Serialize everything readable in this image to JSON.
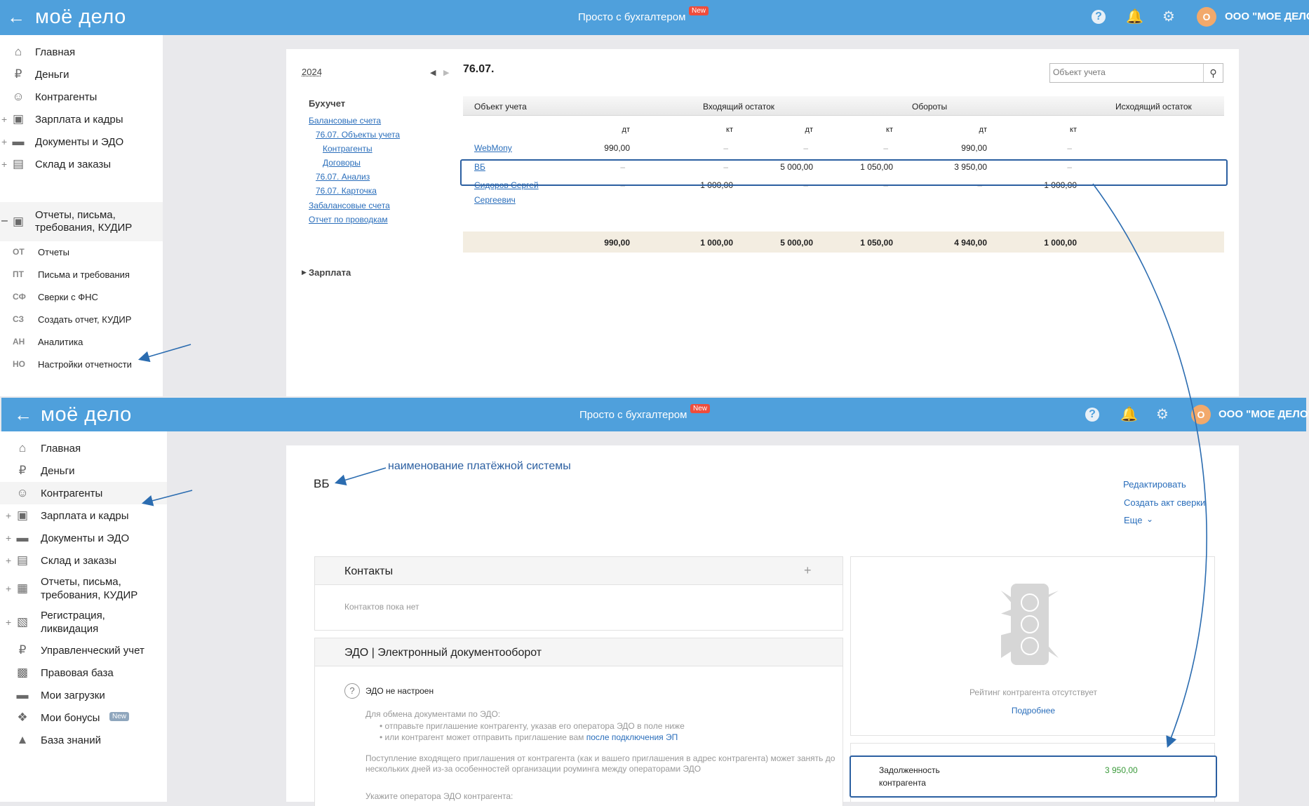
{
  "header": {
    "back_icon": "arrow-left-icon",
    "logo": "моё дело",
    "promo": "Просто с бухгалтером",
    "new_badge": "New",
    "avatar_letter": "О",
    "org_name": "ООО \"МОЕ ДЕЛО\"",
    "icons": [
      "help-icon",
      "bell-icon",
      "gear-icon"
    ]
  },
  "sidebar_top": {
    "items": [
      {
        "label": "Главная",
        "icon": "home-icon",
        "plus": ""
      },
      {
        "label": "Деньги",
        "icon": "money-icon",
        "plus": ""
      },
      {
        "label": "Контрагенты",
        "icon": "person-icon",
        "plus": ""
      },
      {
        "label": "Зарплата и кадры",
        "icon": "wallet-icon",
        "plus": "+"
      },
      {
        "label": "Документы и ЭДО",
        "icon": "folder-icon",
        "plus": "+"
      },
      {
        "label": "Склад и заказы",
        "icon": "cart-icon",
        "plus": "+"
      }
    ],
    "reports": {
      "minus": "–",
      "line1": "Отчеты, письма,",
      "line2": "требования, КУДИР"
    },
    "subitems": [
      {
        "abbr": "ОТ",
        "label": "Отчеты"
      },
      {
        "abbr": "ПТ",
        "label": "Письма и требования"
      },
      {
        "abbr": "СФ",
        "label": "Сверки с ФНС"
      },
      {
        "abbr": "СЗ",
        "label": "Создать отчет, КУДИР"
      },
      {
        "abbr": "АН",
        "label": "Аналитика"
      },
      {
        "abbr": "НО",
        "label": "Настройки отчетности"
      }
    ]
  },
  "report": {
    "year": "2024",
    "title": "76.07.",
    "search_placeholder": "Объект учета",
    "nav": {
      "section": "Бухучет",
      "links": [
        "Балансовые счета",
        "76.07. Объекты учета",
        "Контрагенты",
        "Договоры",
        "76.07. Анализ",
        "76.07. Карточка",
        "Забалансовые счета",
        "Отчет по проводкам"
      ],
      "salary": "Зарплата"
    },
    "table": {
      "headers": [
        "Объект учета",
        "Входящий остаток",
        "Обороты",
        "Исходящий остаток"
      ],
      "sub": [
        "дт",
        "кт",
        "дт",
        "кт",
        "дт",
        "кт"
      ],
      "rows": [
        {
          "name": "WebMony",
          "name2": "",
          "v": [
            "990,00",
            "–",
            "–",
            "–",
            "990,00",
            "–"
          ]
        },
        {
          "name": "ВБ",
          "name2": "",
          "v": [
            "–",
            "–",
            "5 000,00",
            "1 050,00",
            "3 950,00",
            "–"
          ]
        },
        {
          "name": "Сидоров Сергей",
          "name2": "Сергеевич",
          "v": [
            "–",
            "1 000,00",
            "–",
            "–",
            "–",
            "1 000,00"
          ]
        }
      ],
      "totals": [
        "990,00",
        "1 000,00",
        "5 000,00",
        "1 050,00",
        "4 940,00",
        "1 000,00"
      ]
    }
  },
  "sidebar_bottom": {
    "items": [
      {
        "label": "Главная",
        "label2": "",
        "icon": "home-icon",
        "plus": ""
      },
      {
        "label": "Деньги",
        "label2": "",
        "icon": "money-icon",
        "plus": ""
      },
      {
        "label": "Контрагенты",
        "label2": "",
        "icon": "person-icon",
        "plus": ""
      },
      {
        "label": "Зарплата и кадры",
        "label2": "",
        "icon": "wallet-icon",
        "plus": "+"
      },
      {
        "label": "Документы и ЭДО",
        "label2": "",
        "icon": "folder-icon",
        "plus": "+"
      },
      {
        "label": "Склад и заказы",
        "label2": "",
        "icon": "cart-icon",
        "plus": "+"
      },
      {
        "label": "Отчеты, письма,",
        "label2": "требования, КУДИР",
        "icon": "report-icon",
        "plus": "+"
      },
      {
        "label": "Регистрация,",
        "label2": "ликвидация",
        "icon": "registration-icon",
        "plus": "+"
      },
      {
        "label": "Управленческий учет",
        "label2": "",
        "icon": "ruble-icon",
        "plus": ""
      },
      {
        "label": "Правовая база",
        "label2": "",
        "icon": "briefcase-icon",
        "plus": ""
      },
      {
        "label": "Мои загрузки",
        "label2": "",
        "icon": "folder-icon",
        "plus": ""
      },
      {
        "label": "Мои бонусы",
        "label2": "",
        "icon": "gift-icon",
        "plus": "",
        "badge": "New"
      },
      {
        "label": "База знаний",
        "label2": "",
        "icon": "graduation-icon",
        "plus": ""
      }
    ]
  },
  "card": {
    "name": "ВБ",
    "annotation": "наименование платёжной системы",
    "actions": [
      "Редактировать",
      "Создать акт сверки",
      "Еще"
    ],
    "contacts": {
      "title": "Контакты",
      "add": "+",
      "empty": "Контактов пока нет"
    },
    "edo": {
      "title": "ЭДО | Электронный документооборот",
      "status": "ЭДО не настроен",
      "intro": "Для обмена документами по ЭДО:",
      "bullet1": "отправьте приглашение контрагенту, указав его оператора ЭДО в поле ниже",
      "bullet2_prefix": "или контрагент может отправить приглашение вам ",
      "bullet2_link": "после подключения ЭП",
      "note": "Поступление входящего приглашения от контрагента (как и вашего приглашения в адрес контрагента) может занять до нескольких дней из-за особенностей организации роуминга между операторами ЭДО",
      "operator": "Укажите оператора ЭДО контрагента:"
    },
    "rating": {
      "text": "Рейтинг контрагента отсутствует",
      "link": "Подробнее"
    },
    "debt": {
      "label1": "Задолженность",
      "label2": "контрагента",
      "value": "3 950,00"
    }
  },
  "colors": {
    "header": "#4fa0dc",
    "link": "#2a6ebb",
    "highlight": "#2b5fa1",
    "debt": "#3a9a3a",
    "totals_bg": "#f3ede1"
  }
}
